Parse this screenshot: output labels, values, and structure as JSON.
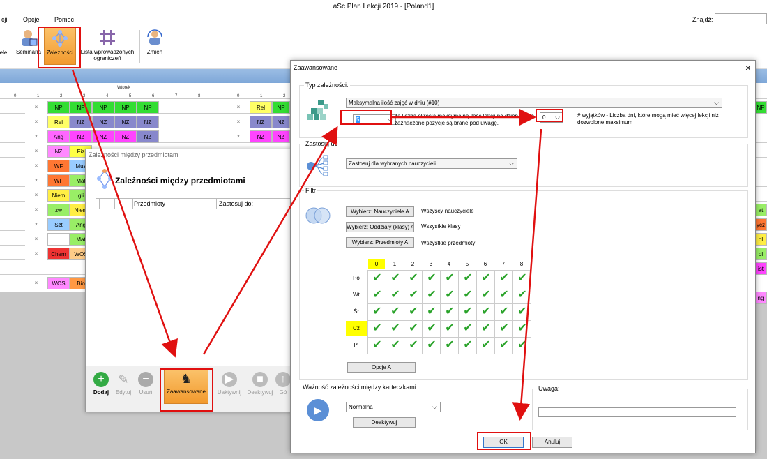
{
  "app": {
    "title": "aSc Plan Lekcji 2019  - [Poland1]"
  },
  "menu": {
    "items": [
      "cji",
      "Opcje",
      "Pomoc"
    ]
  },
  "search": {
    "label": "Znajdź:"
  },
  "ribbon": {
    "items": [
      {
        "label": "ele"
      },
      {
        "label": "Seminaria"
      },
      {
        "label": "Zależności"
      },
      {
        "label": "Lista wprowadzonych ograniczeń"
      },
      {
        "label": "Zmień"
      }
    ]
  },
  "timetable": {
    "day_header": "Wtorek",
    "periods_a": [
      "0",
      "1",
      "2",
      "3",
      "4",
      "5",
      "6",
      "7",
      "8"
    ],
    "periods_b": [
      "0",
      "1",
      "2",
      "3",
      "4",
      "5",
      "6"
    ],
    "cells": [
      {
        "t": "×",
        "c": "#fff"
      },
      {
        "t": "NP",
        "c": "#33dd33"
      },
      {
        "t": "NP",
        "c": "#33dd33"
      },
      {
        "t": "NP",
        "c": "#33dd33"
      },
      {
        "t": "NP",
        "c": "#33dd33"
      },
      {
        "t": "NP",
        "c": "#33dd33"
      },
      {
        "t": "×",
        "c": "#fff"
      },
      {
        "t": "Rel",
        "c": "#ffff66"
      },
      {
        "t": "NZ",
        "c": "#8888cc"
      },
      {
        "t": "NZ",
        "c": "#8888cc"
      },
      {
        "t": "NZ",
        "c": "#8888cc"
      },
      {
        "t": "NZ",
        "c": "#8888cc"
      },
      {
        "t": "×",
        "c": "#fff"
      },
      {
        "t": "Ang",
        "c": "#ff66ff"
      },
      {
        "t": "NZ",
        "c": "#ff44ff"
      },
      {
        "t": "NZ",
        "c": "#ff44ff"
      },
      {
        "t": "NZ",
        "c": "#ff44ff"
      },
      {
        "t": "NZ",
        "c": "#8888cc"
      },
      {
        "t": "×",
        "c": "#fff"
      },
      {
        "t": "NZ",
        "c": "#ff88ff"
      },
      {
        "t": "Fiz",
        "c": "#ffff44"
      },
      {
        "t": "×",
        "c": "#fff"
      },
      {
        "t": "WF",
        "c": "#ff7733"
      },
      {
        "t": "Muz",
        "c": "#99ccff"
      },
      {
        "t": "×",
        "c": "#fff"
      },
      {
        "t": "WF",
        "c": "#ff7733"
      },
      {
        "t": "Mat",
        "c": "#99ee66"
      },
      {
        "t": "×",
        "c": "#fff"
      },
      {
        "t": "Niem",
        "c": "#ffee44"
      },
      {
        "t": "gli",
        "c": "#99ee66"
      },
      {
        "t": "×",
        "c": "#fff"
      },
      {
        "t": "zw",
        "c": "#99ee66"
      },
      {
        "t": "Niem",
        "c": "#ffee44"
      },
      {
        "t": "×",
        "c": "#fff"
      },
      {
        "t": "Szt",
        "c": "#99ccff"
      },
      {
        "t": "Ang",
        "c": "#99ee66"
      },
      {
        "t": "×",
        "c": "#fff"
      },
      {
        "t": "",
        "c": "#fff"
      },
      {
        "t": "Mat",
        "c": "#99ee66"
      },
      {
        "t": "×",
        "c": "#fff"
      },
      {
        "t": "Chem",
        "c": "#ee3333"
      },
      {
        "t": "WOS",
        "c": "#ffcc88"
      },
      {
        "t": "×",
        "c": "#fff"
      },
      {
        "t": "WOS",
        "c": "#ff88ff"
      },
      {
        "t": "Bio",
        "c": "#ff9944"
      }
    ],
    "right_edge": [
      "NP",
      "",
      "",
      "at",
      "ycz",
      "ol",
      "ol",
      "ist",
      "",
      "ng"
    ]
  },
  "back_dialog": {
    "title": "Zależności między przedmiotami",
    "heading": "Zależności między przedmiotami",
    "col_przedmioty": "Przedmioty",
    "col_zastosuj": "Zastosuj do:",
    "buttons": {
      "add": "Dodaj",
      "edit": "Edytuj",
      "delete": "Usuń",
      "advanced": "Zaawansowane",
      "activate": "Uaktywnij",
      "deactivate": "Deaktywuj",
      "up": "Gó"
    }
  },
  "dialog": {
    "title": "Zaawansowane",
    "close": "×",
    "type_group": "Typ zależności:",
    "type_select": "Maksymalna ilość zajęć w dniu (#10)",
    "count_value": "5",
    "desc": "Ta liczba określa maksymalną ilość lekcji na dzień. Tylko zaznaczone pozycje są brane pod uwagę.",
    "exceptions_value": "0",
    "exceptions_desc": "# wyjątków - Liczba dni, które mogą mieć więcej lekcji niż dozwolone maksimum",
    "apply_group": "Zastosuj do",
    "apply_select": "Zastosuj dla wybranych nauczycieli",
    "filter_group": "Filtr",
    "filter": {
      "btn_teachers": "Wybierz: Nauczyciele A",
      "teachers_value": "Wszyscy nauczyciele",
      "btn_classes": "Wybierz: Oddziały (klasy) A",
      "classes_value": "Wszystkie klasy",
      "btn_subjects": "Wybierz: Przedmioty A",
      "subjects_value": "Wszystkie przedmioty"
    },
    "grid": {
      "cols": [
        "0",
        "1",
        "2",
        "3",
        "4",
        "5",
        "6",
        "7",
        "8"
      ],
      "rows": [
        "Po",
        "Wt",
        "Śr",
        "Cz",
        "Pi"
      ],
      "highlight_col": "#ffff00",
      "highlight_row": "#ffff00"
    },
    "options_button": "Opcje A",
    "importance_group": "Ważność zależności między karteczkami:",
    "importance_select": "Normalna",
    "deactivate_button": "Deaktywuj",
    "note_label": "Uwaga:",
    "ok": "OK",
    "cancel": "Anuluj"
  },
  "colors": {
    "annotation": "#e01010",
    "check": "#2aa32a",
    "ribbon_active": "#f7a440"
  }
}
